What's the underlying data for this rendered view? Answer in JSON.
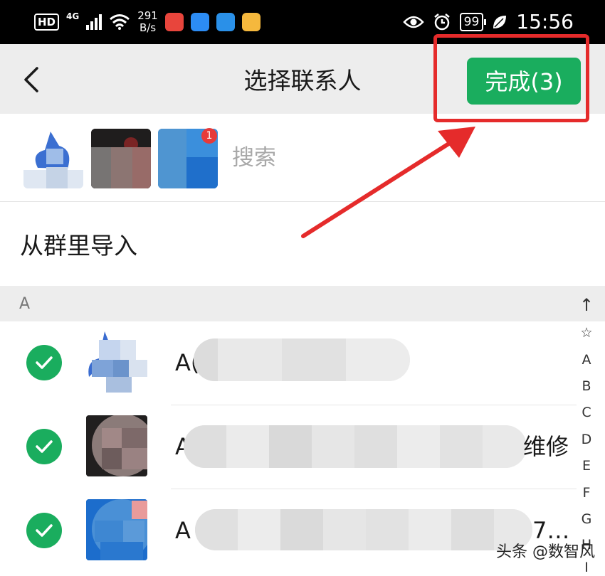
{
  "status_bar": {
    "hd": "HD",
    "network": "4G",
    "speed_value": "291",
    "speed_unit": "B/s",
    "battery": "99",
    "time": "15:56"
  },
  "header": {
    "title": "选择联系人",
    "done_label": "完成(3)"
  },
  "selected": {
    "badge_count": "1",
    "search_placeholder": "搜索"
  },
  "import_from_group": "从群里导入",
  "section_letter": "A",
  "contacts": [
    {
      "name_visible": "A(",
      "tail_visible": "",
      "checked": true
    },
    {
      "name_visible": "A",
      "tail_visible": "维修",
      "checked": true
    },
    {
      "name_visible": "A",
      "tail_visible": "7…",
      "checked": true
    }
  ],
  "index_bar": [
    "↑",
    "☆",
    "A",
    "B",
    "C",
    "D",
    "E",
    "F",
    "G",
    "H",
    "I"
  ],
  "watermark": "头条 @数智风",
  "colors": {
    "accent_green": "#1aad5e",
    "annotation_red": "#e52b2b",
    "badge_red": "#e63a3a"
  }
}
